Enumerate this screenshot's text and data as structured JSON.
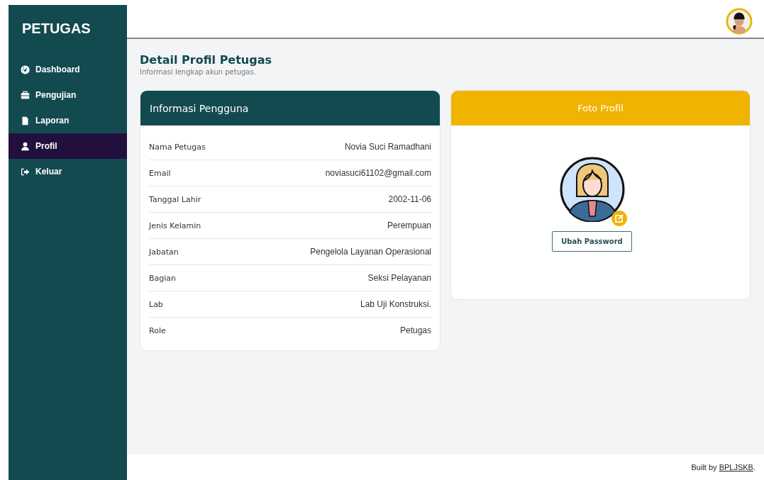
{
  "sidebar": {
    "brand": "PETUGAS",
    "items": [
      {
        "label": "Dashboard",
        "selected": false
      },
      {
        "label": "Pengujian",
        "selected": false
      },
      {
        "label": "Laporan",
        "selected": false
      },
      {
        "label": "Profil",
        "selected": true
      },
      {
        "label": "Keluar",
        "selected": false
      }
    ]
  },
  "page": {
    "title": "Detail Profil Petugas",
    "subtitle": "Informasi lengkap akun petugas."
  },
  "info_card": {
    "title": "Informasi Pengguna",
    "rows": [
      {
        "label": "Nama Petugas",
        "value": "Novia Suci Ramadhani"
      },
      {
        "label": "Email",
        "value": "noviasuci61102@gmail.com"
      },
      {
        "label": "Tanggal Lahir",
        "value": "2002-11-06"
      },
      {
        "label": "Jenis Kelamin",
        "value": "Perempuan"
      },
      {
        "label": "Jabatan",
        "value": "Pengelola Layanan Operasional"
      },
      {
        "label": "Bagian",
        "value": "Seksi Pelayanan"
      },
      {
        "label": "Lab",
        "value": "Lab Uji Konstruksi."
      },
      {
        "label": "Role",
        "value": "Petugas"
      }
    ]
  },
  "photo_card": {
    "title": "Foto Profil",
    "button": "Ubah Password"
  },
  "footer": {
    "prefix": "Built by ",
    "link": "BPLJSKB",
    "suffix": "."
  }
}
